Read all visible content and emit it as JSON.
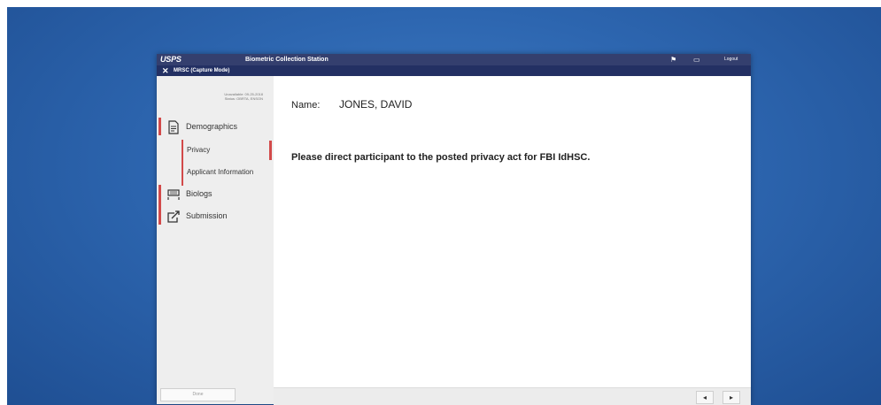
{
  "titlebar": {
    "logo": "USPS",
    "title": "Biometric Collection Station",
    "icons": {
      "flag": "flag-icon",
      "monitor": "monitor-icon"
    },
    "link": "Logout"
  },
  "subbar": {
    "close_icon": "close-x-icon",
    "mode": "MRSC (Capture Mode)"
  },
  "sidebar": {
    "info_line1": "Unavailable: 09-25-2018",
    "info_line2": "Status: OBRTA, ENSON",
    "steps": [
      {
        "label": "Demographics",
        "icon": "document-icon"
      },
      {
        "label": "Biologs",
        "icon": "fingerprint-scanner-icon"
      },
      {
        "label": "Submission",
        "icon": "export-icon"
      }
    ],
    "substeps": [
      {
        "label": "Privacy"
      },
      {
        "label": "Applicant Information"
      }
    ],
    "done_button": "Done"
  },
  "main": {
    "name_label": "Name:",
    "name_value": "JONES, DAVID",
    "message": "Please direct participant to the posted privacy act for FBI IdHSC."
  },
  "footer": {
    "back_label": "◂",
    "next_label": "▸"
  },
  "colors": {
    "titlebar": "#343f6e",
    "subbar": "#233063",
    "accent_red": "#d24a4a",
    "desktop": "#2d66b0"
  }
}
